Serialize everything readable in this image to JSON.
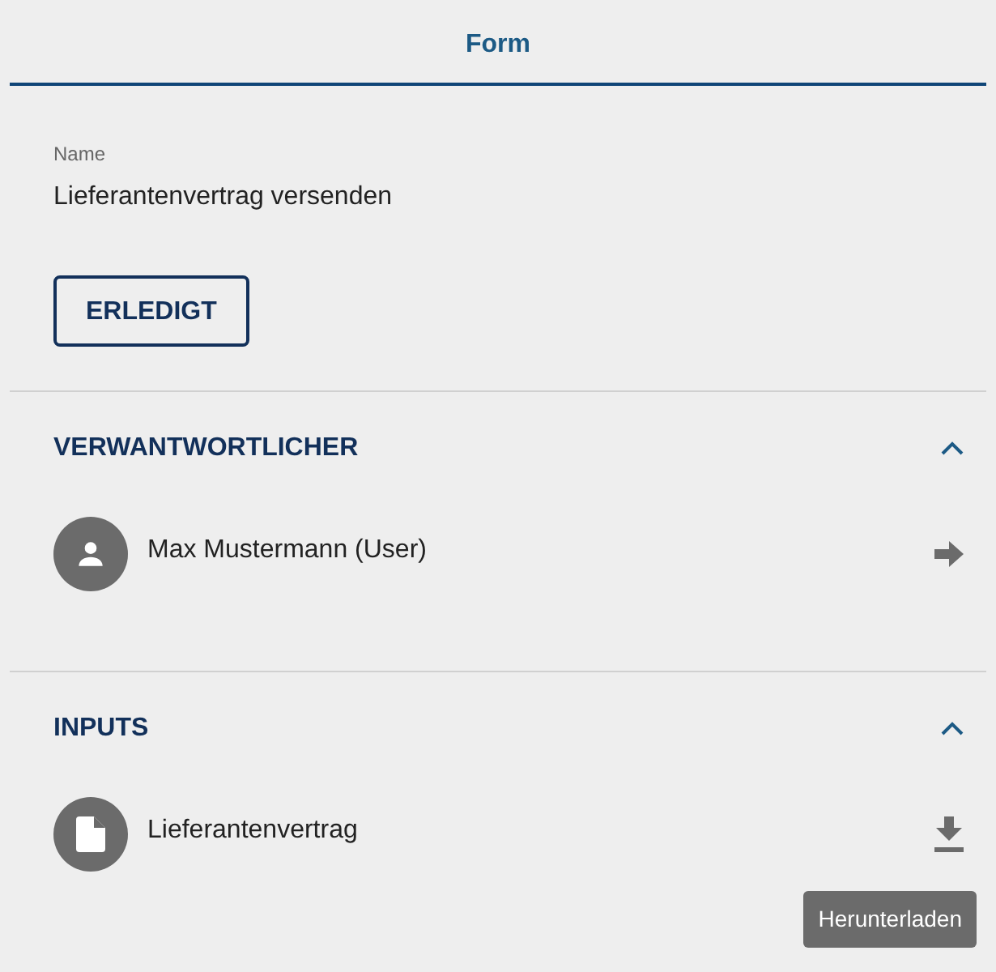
{
  "tabs": [
    {
      "label": "Form",
      "selected": true
    }
  ],
  "name_field": {
    "label": "Name",
    "value": "Lieferantenvertrag versenden"
  },
  "done_button": {
    "label": "ERLEDIGT"
  },
  "sections": [
    {
      "title": "VERWANTWORTLICHER",
      "expanded": true,
      "items": [
        {
          "kind": "person",
          "label": "Max Mustermann (User)"
        }
      ]
    },
    {
      "title": "INPUTS",
      "expanded": true,
      "items": [
        {
          "kind": "document",
          "label": "Lieferantenvertrag",
          "tooltip": "Herunterladen"
        }
      ]
    }
  ]
}
